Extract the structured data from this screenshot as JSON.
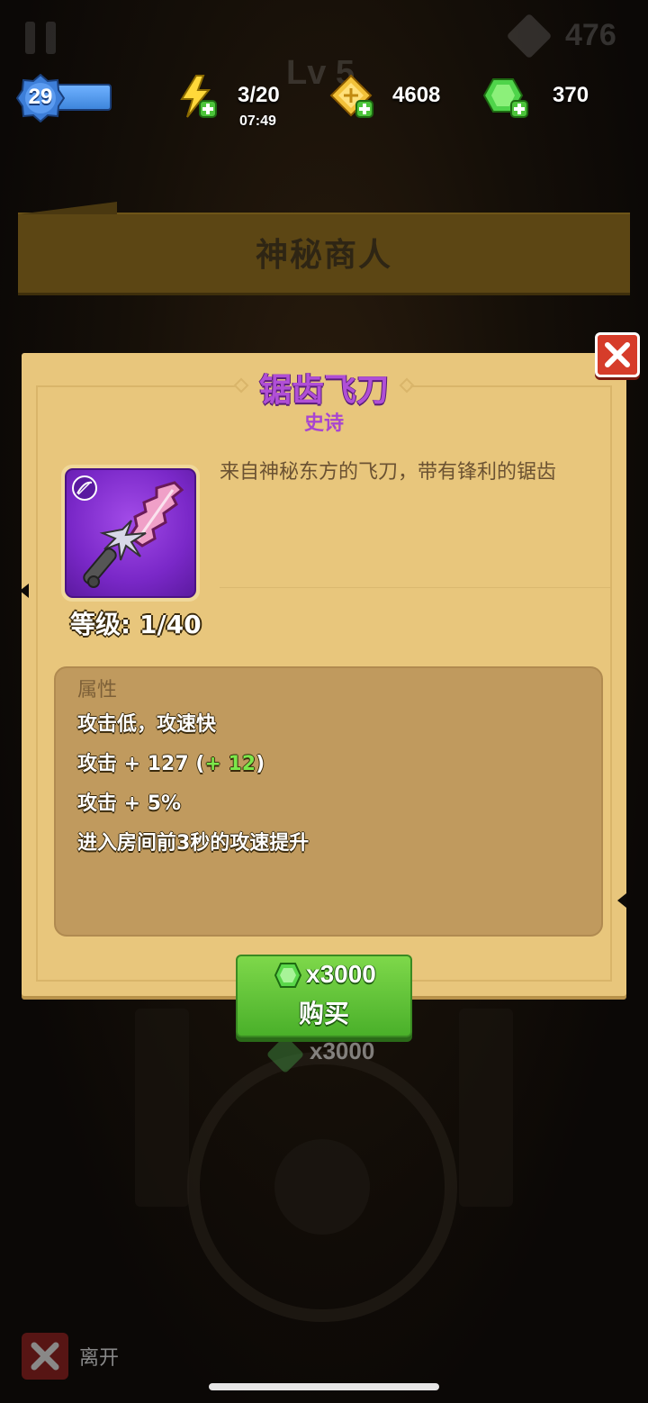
{
  "hud": {
    "player_level": "29",
    "xp_progress": 1.0,
    "energy": "3/20",
    "energy_timer": "07:49",
    "gold": "4608",
    "gems": "370"
  },
  "background": {
    "top_right_value": "476",
    "level_label": "Lv 5",
    "price_behind": "x3000"
  },
  "header": {
    "title": "神秘商人"
  },
  "item": {
    "name": "锯齿飞刀",
    "rarity": "史诗",
    "description": "来自神秘东方的飞刀，带有锋利的锯齿",
    "level_label": "等级: 1/40"
  },
  "stats": {
    "heading": "属性",
    "lines": {
      "l0": "攻击低，攻速快",
      "l1_prefix": "攻击 + 127 (",
      "l1_bonus": "+ 12",
      "l1_suffix": ")",
      "l2": "攻击 + 5%",
      "l3": "进入房间前3秒的攻速提升"
    }
  },
  "buy": {
    "price": "x3000",
    "label": "购买"
  },
  "leave": {
    "label": "离开"
  },
  "colors": {
    "rarity_epic": "#b04fd6",
    "panel_bg": "#e8c67c",
    "buy_green": "#4ab02a",
    "close_red": "#d63c2a"
  }
}
